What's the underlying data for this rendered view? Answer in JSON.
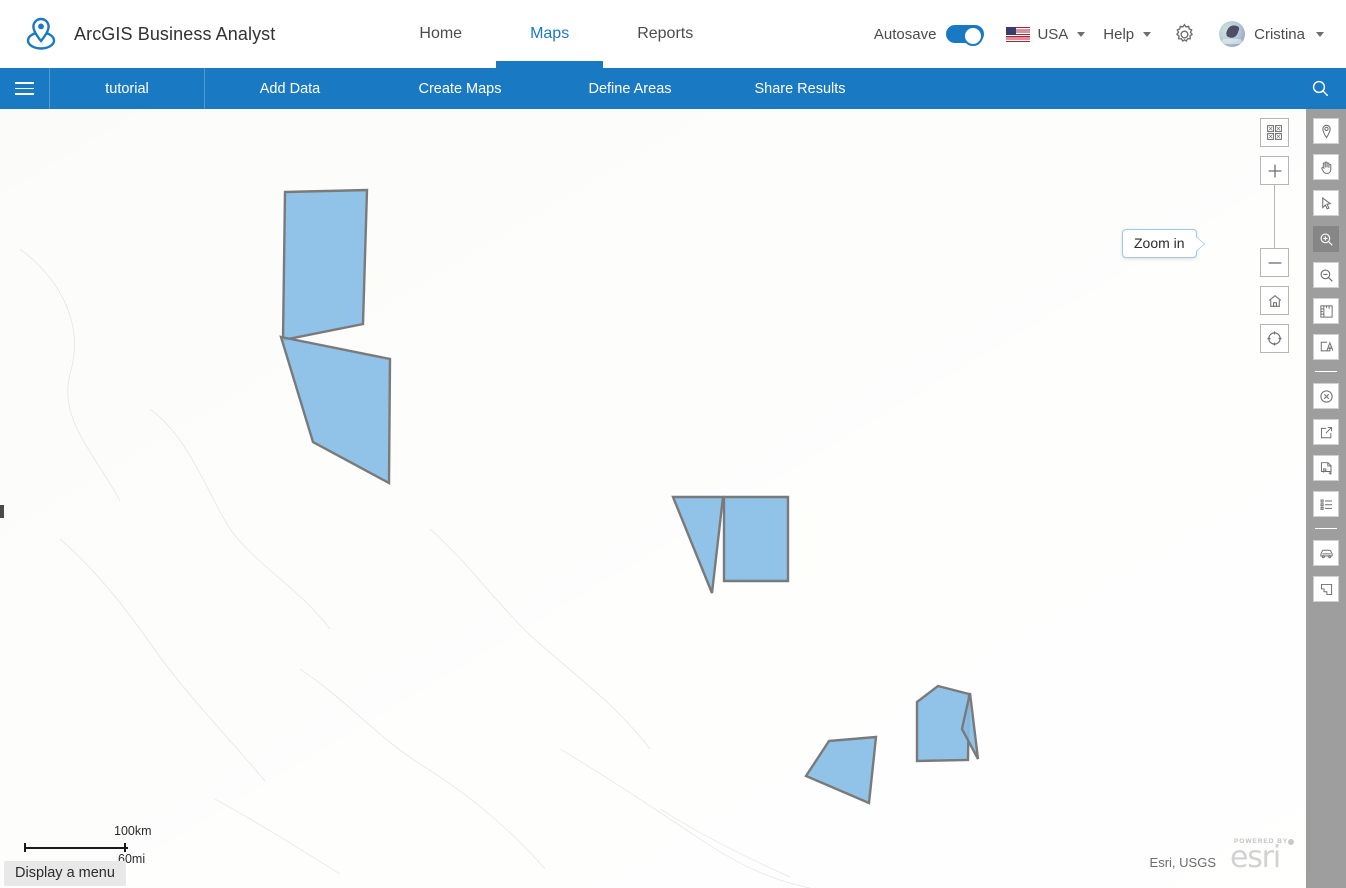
{
  "app": {
    "title": "ArcGIS Business Analyst",
    "logo_icon": "location-pin-logo"
  },
  "header": {
    "nav": [
      {
        "label": "Home",
        "active": false
      },
      {
        "label": "Maps",
        "active": true
      },
      {
        "label": "Reports",
        "active": false
      }
    ],
    "autosave": {
      "label": "Autosave",
      "enabled": true,
      "accent": "#1a79c3"
    },
    "region": {
      "label": "USA",
      "icon": "us-flag-icon"
    },
    "help": {
      "label": "Help",
      "icon": "chevron-down-icon"
    },
    "settings_icon": "gear-icon",
    "user": {
      "name": "Cristina",
      "avatar_icon": "user-avatar"
    }
  },
  "subbar": {
    "menu_icon": "hamburger-icon",
    "project": "tutorial",
    "steps": [
      {
        "label": "Add Data"
      },
      {
        "label": "Create Maps"
      },
      {
        "label": "Define Areas"
      },
      {
        "label": "Share Results"
      }
    ],
    "search_icon": "search-icon",
    "background": "#1a79c3"
  },
  "map": {
    "basemap": "light-gray-hillshade",
    "scalebar": {
      "metric": "100km",
      "imperial": "60mi"
    },
    "menu_tooltip": "Display a menu",
    "attribution": "Esri, USGS",
    "esri_logo": {
      "powered_by": "POWERED BY",
      "wordmark": "esri"
    },
    "tooltip": {
      "text": "Zoom in",
      "target": "zoom-in-tool"
    },
    "controls": [
      {
        "name": "basemap-gallery-button",
        "icon": "basemap-grid-icon"
      },
      {
        "name": "zoom-in-button",
        "icon": "plus-icon"
      },
      {
        "name": "zoom-out-button",
        "icon": "minus-icon"
      },
      {
        "name": "home-button",
        "icon": "home-icon"
      },
      {
        "name": "locate-button",
        "icon": "compass-locate-icon"
      }
    ],
    "polygon_style": {
      "fill": "#84bce4",
      "stroke": "#7a7a7a",
      "opacity": 0.85
    },
    "features": [
      {
        "id": "area-1",
        "shape": "quadrilateral"
      },
      {
        "id": "area-2",
        "shape": "quadrilateral"
      },
      {
        "id": "area-3",
        "shape": "triangle"
      },
      {
        "id": "area-4",
        "shape": "rectangle"
      },
      {
        "id": "area-5",
        "shape": "pentagon"
      },
      {
        "id": "area-6",
        "shape": "sliver"
      },
      {
        "id": "area-7",
        "shape": "quadrilateral"
      }
    ]
  },
  "right_rail": {
    "tools": [
      {
        "name": "add-point-tool",
        "icon": "map-pin-icon",
        "active": false
      },
      {
        "name": "pan-tool",
        "icon": "hand-icon",
        "active": false
      },
      {
        "name": "select-tool",
        "icon": "cursor-arrow-icon",
        "active": false
      },
      {
        "name": "zoom-in-tool",
        "icon": "magnifier-plus-icon",
        "active": true
      },
      {
        "name": "zoom-out-tool",
        "icon": "magnifier-minus-icon",
        "active": false
      },
      {
        "name": "measure-tool",
        "icon": "ruler-icon",
        "active": false
      },
      {
        "name": "text-label-tool",
        "icon": "text-box-icon",
        "active": false
      },
      {
        "name": "clear-tool",
        "icon": "close-circle-icon",
        "active": false
      },
      {
        "name": "export-tool",
        "icon": "export-arrow-icon",
        "active": false
      },
      {
        "name": "pdf-export-tool",
        "icon": "pdf-export-icon",
        "active": false
      },
      {
        "name": "legend-tool",
        "icon": "list-icon",
        "active": false
      },
      {
        "name": "drive-time-tool",
        "icon": "car-icon",
        "active": false
      },
      {
        "name": "draw-polygon-tool",
        "icon": "polygon-icon",
        "active": false
      }
    ],
    "background": "#9e9e9e"
  }
}
